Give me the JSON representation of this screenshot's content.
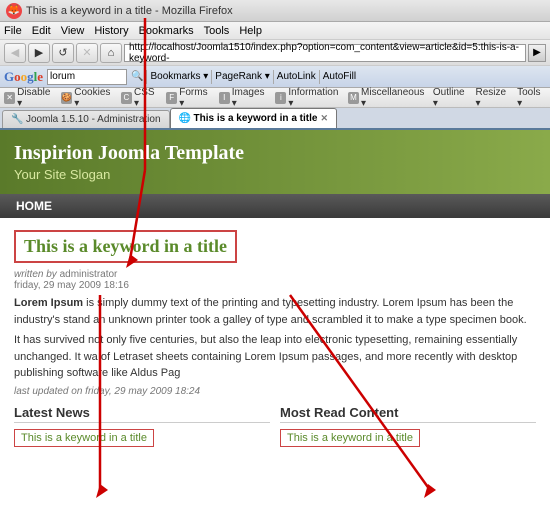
{
  "browser": {
    "title": "This is a keyword in a title - Mozilla Firefox",
    "menu_items": [
      "File",
      "Edit",
      "View",
      "History",
      "Bookmarks",
      "Tools",
      "Help"
    ],
    "address": "http://localhost/Joomla1510/index.php?option=com_content&view=article&id=5:this-is-a-keyword-",
    "nav_buttons": {
      "back": "◀",
      "forward": "▶",
      "reload": "↺",
      "stop": "✕",
      "home": "⌂"
    },
    "google_search_value": "lorum",
    "tabs": [
      {
        "label": "Joomla 1.5.10 - Administration",
        "active": false
      },
      {
        "label": "This is a keyword in a title",
        "active": true
      }
    ],
    "toolbar_items": [
      "Disable ▾",
      "Cookies ▾",
      "CSS ▾",
      "Forms ▾",
      "Images ▾",
      "Information ▾",
      "Miscellaneous ▾",
      "Outline ▾",
      "Resize ▾",
      "Tools ▾"
    ]
  },
  "site": {
    "title": "Inspirion Joomla Template",
    "slogan": "Your Site Slogan",
    "nav": [
      {
        "label": "HOME"
      }
    ],
    "article": {
      "title": "This is a keyword in a title",
      "written_by_label": "written by",
      "author": "administrator",
      "date_label": "friday, 29 may 2009 18:16",
      "body_part1": "Lorem Ipsum",
      "body_text1": " is simply dummy text of the printing and typesetting industry. Lorem Ipsum has been the industry's stand an unknown printer took a galley of type and scrambled it to make a type specimen book.",
      "body_text2": "It has survived not only five centuries, but also the leap into electronic typesetting, remaining essentially unchanged. It wa of Letraset sheets containing Lorem Ipsum passages, and more recently with desktop publishing software like Aldus Pag",
      "updated_label": "last updated on friday, 29 may 2009 18:24"
    },
    "latest_news": {
      "heading": "Latest News",
      "items": [
        {
          "label": "This is a keyword in a title"
        }
      ]
    },
    "most_read": {
      "heading": "Most Read Content",
      "items": [
        {
          "label": "This is a keyword in a title"
        }
      ]
    }
  }
}
